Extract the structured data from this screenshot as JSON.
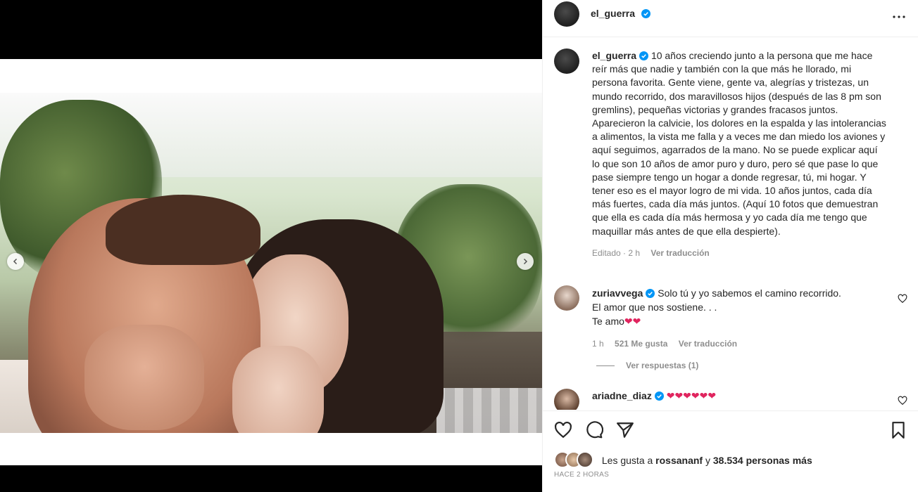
{
  "post": {
    "author": "el_guerra",
    "more_icon": "more-horizontal-icon"
  },
  "caption": {
    "author": "el_guerra",
    "text": "10 años creciendo junto a la persona que me hace reír más que nadie y también con la que más he llorado, mi persona favorita. Gente viene, gente va, alegrías y tristezas, un mundo recorrido, dos maravillosos hijos (después de las 8 pm son gremlins), pequeñas victorias y grandes fracasos juntos. Aparecieron la calvicie, los dolores en la espalda y las intolerancias a alimentos, la vista me falla y a veces me dan miedo los aviones y aquí seguimos, agarrados de la mano. No se puede explicar aquí lo que son 10 años de amor puro y duro, pero sé que pase lo que pase siempre tengo un hogar a donde regresar, tú, mi hogar. Y tener eso es el mayor logro de mi vida. 10 años juntos, cada día más fuertes, cada día más juntos. (Aquí 10 fotos que demuestran que ella es cada día más hermosa y yo cada día me tengo que maquillar más antes de que ella despierte).",
    "edited": "Editado · 2 h",
    "translate": "Ver traducción"
  },
  "comments": [
    {
      "author": "zuriavvega",
      "line1": "Solo tú y yo sabemos el camino recorrido.",
      "line2": "El amor que nos sostiene. . .",
      "line3": "Te amo",
      "hearts": "❤❤",
      "time": "1 h",
      "likes": "521 Me gusta",
      "translate": "Ver traducción",
      "replies": "Ver respuestas (1)"
    },
    {
      "author": "ariadne_diaz",
      "hearts": "❤❤❤❤❤❤"
    }
  ],
  "likes": {
    "prefix": "Les gusta a",
    "user": "rossananf",
    "conj": "y",
    "others": "38.534 personas más"
  },
  "timestamp": "HACE 2 HORAS",
  "colors": {
    "verified": "#0095f6",
    "heart": "#e0245e",
    "muted": "#8e8e8e",
    "text": "#262626"
  }
}
